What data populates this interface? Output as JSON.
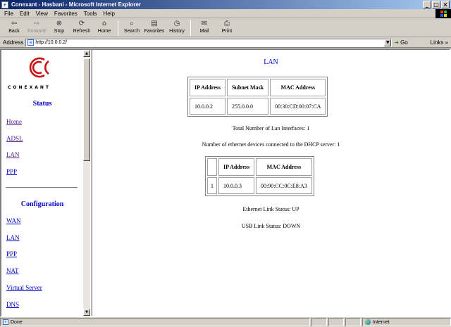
{
  "window": {
    "title": "Conexant - Hasbani - Microsoft Internet Explorer",
    "minimize": "_",
    "maximize": "□",
    "close": "×"
  },
  "menu": [
    "File",
    "Edit",
    "View",
    "Favorites",
    "Tools",
    "Help"
  ],
  "toolbar": {
    "back": "Back",
    "forward": "Forward",
    "stop": "Stop",
    "refresh": "Refresh",
    "home": "Home",
    "search": "Search",
    "favorites": "Favorites",
    "history": "History",
    "mail": "Mail",
    "print": "Print"
  },
  "address": {
    "label": "Address",
    "url": "http://10.0.0.2/",
    "go": "Go",
    "links": "Links »"
  },
  "sidebar": {
    "logo_text": "CONEXANT",
    "logo_color": "#cc1111",
    "status_heading": "Status",
    "status_links": [
      "Home",
      "ADSL",
      "LAN",
      "PPP"
    ],
    "config_heading": "Configuration",
    "config_links": [
      "WAN",
      "LAN",
      "PPP",
      "NAT",
      "Virtual Server",
      "DNS"
    ]
  },
  "main": {
    "title": "LAN",
    "lan_table": {
      "headers": [
        "IP Address",
        "Subnet Mask",
        "MAC Address"
      ],
      "row": [
        "10.0.0.2",
        "255.0.0.0",
        "00:30:CD:00:07:CA"
      ]
    },
    "total_interfaces": "Total Number of Lan Interfaces: 1",
    "dhcp_devices": "Number of ethernet devices connected to the DHCP server: 1",
    "dhcp_table": {
      "headers": [
        "",
        "IP Address",
        "MAC Address"
      ],
      "row": [
        "1",
        "10.0.0.3",
        "00:90:CC:0C:E8:A3"
      ]
    },
    "ethernet_status": "Ethernet Link Status: UP",
    "usb_status": "USB Link Status: DOWN"
  },
  "statusbar": {
    "left": "Done",
    "zone": "Internet"
  }
}
